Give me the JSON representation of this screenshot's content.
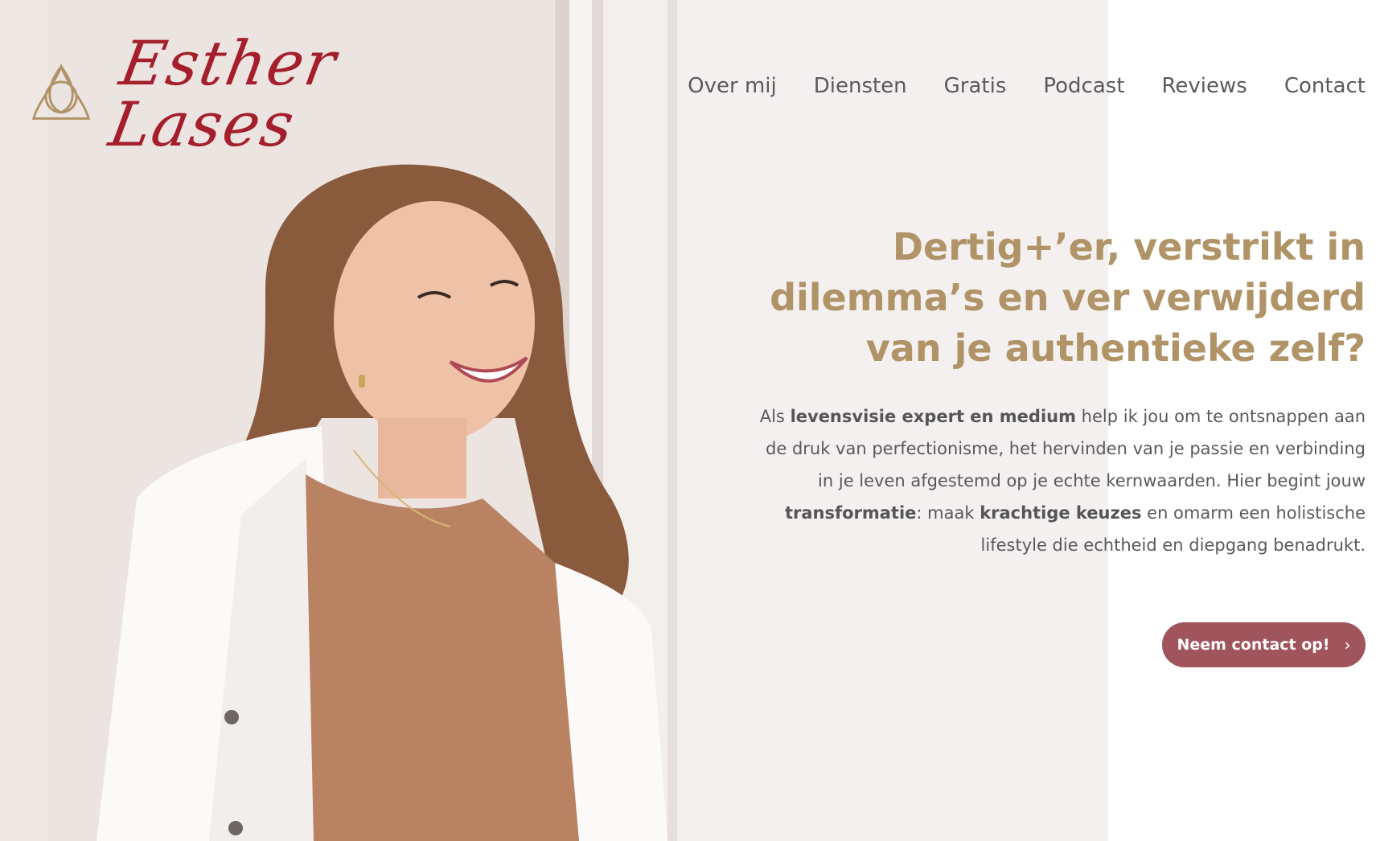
{
  "brand": {
    "name": "Esther Lases",
    "accent": "#a51e2c",
    "gold": "#b09366"
  },
  "nav": {
    "items": [
      {
        "label": "Over mij"
      },
      {
        "label": "Diensten"
      },
      {
        "label": "Gratis"
      },
      {
        "label": "Podcast"
      },
      {
        "label": "Reviews"
      },
      {
        "label": "Contact"
      }
    ]
  },
  "hero": {
    "title_lines": [
      "Dertig+’er, verstrikt in",
      "dilemma’s en ver verwijderd",
      "van je authentieke zelf?"
    ],
    "text_segments": [
      {
        "t": "Als ",
        "b": false
      },
      {
        "t": "levensvisie expert en medium",
        "b": true
      },
      {
        "t": " help ik jou om te ontsnappen aan de druk van perfectionisme, het hervinden van je passie en verbinding in je leven afgestemd op je echte kernwaarden. Hier begint jouw ",
        "b": false
      },
      {
        "t": "transformatie",
        "b": true
      },
      {
        "t": ": maak ",
        "b": false
      },
      {
        "t": "krachtige keuzes",
        "b": true
      },
      {
        "t": " en omarm een holistische lifestyle die echtheid en diepgang benadrukt.",
        "b": false
      }
    ],
    "cta_label": "Neem contact op!",
    "cta_color": "#a0555c"
  },
  "icons": {
    "logo": "triquetra-icon",
    "cta": "chevron-right-icon"
  }
}
